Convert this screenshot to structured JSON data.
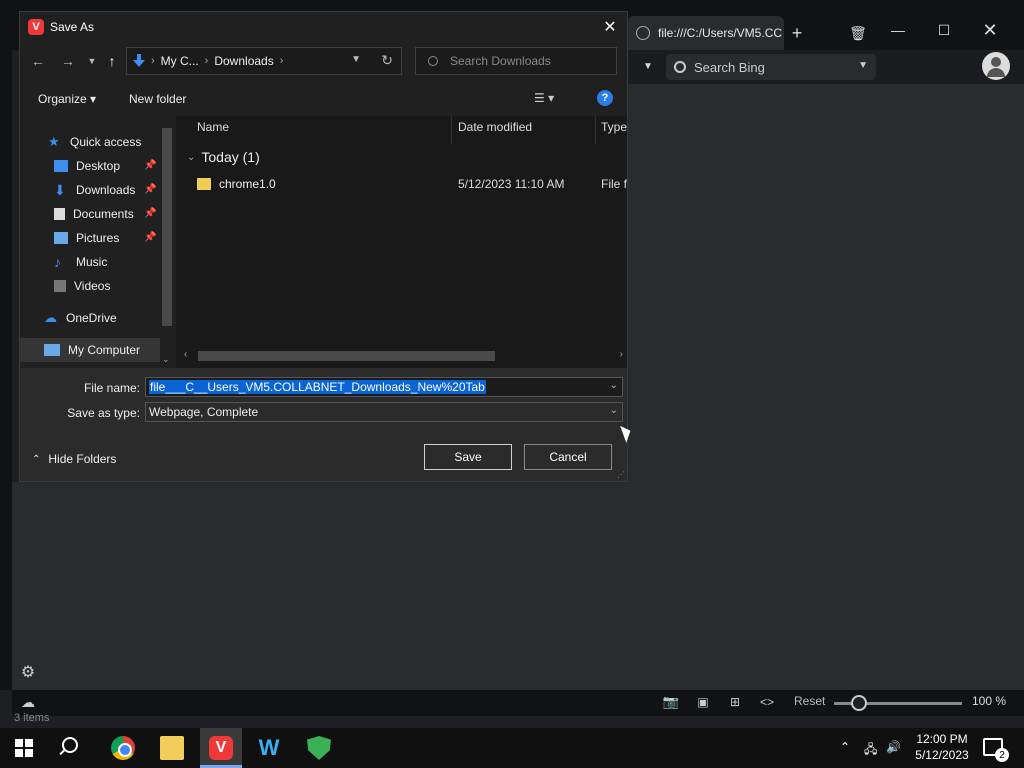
{
  "browser": {
    "tab_title": "file:///C:/Users/VM5.CC",
    "search_placeholder": "Search Bing",
    "status": {
      "reset_label": "Reset",
      "zoom": "100 %",
      "items_text": "3 items"
    }
  },
  "dialog": {
    "title": "Save As",
    "breadcrumb": [
      "My C...",
      "Downloads"
    ],
    "search_placeholder": "Search Downloads",
    "toolbar": {
      "organize": "Organize",
      "new_folder": "New folder"
    },
    "nav": {
      "quick_access": "Quick access",
      "items": [
        "Desktop",
        "Downloads",
        "Documents",
        "Pictures",
        "Music",
        "Videos"
      ],
      "onedrive": "OneDrive",
      "my_computer": "My Computer"
    },
    "columns": {
      "name": "Name",
      "date": "Date modified",
      "type": "Type"
    },
    "group": "Today (1)",
    "files": [
      {
        "name": "chrome1.0",
        "date": "5/12/2023 11:10 AM",
        "type": "File fo"
      }
    ],
    "file_name_label": "File name:",
    "file_name_value": "file___C__Users_VM5.COLLABNET_Downloads_New%20Tab",
    "save_type_label": "Save as type:",
    "save_type_value": "Webpage, Complete",
    "hide_folders": "Hide Folders",
    "save_button": "Save",
    "cancel_button": "Cancel"
  },
  "taskbar": {
    "time": "12:00 PM",
    "date": "5/12/2023",
    "notif_count": "2"
  }
}
